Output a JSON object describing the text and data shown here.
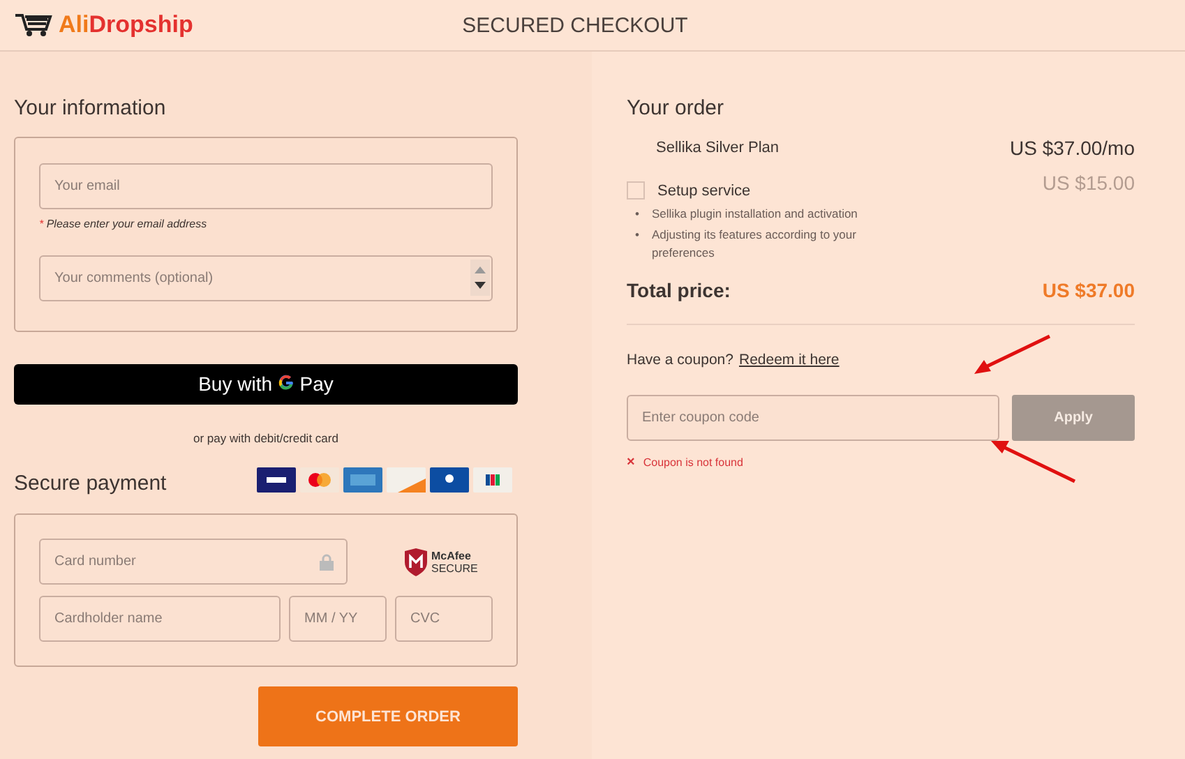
{
  "header": {
    "brand": [
      "Ali",
      "Dropship"
    ],
    "title": "SECURED CHECKOUT"
  },
  "info": {
    "heading": "Your information",
    "email": {
      "placeholder": "Your email"
    },
    "email_hint": "Please enter your email address",
    "hint_mark": "*",
    "comments": {
      "placeholder": "Your comments (optional)"
    }
  },
  "gpay_button": {
    "label": "Buy with",
    "pay": "Pay"
  },
  "or_text": "or pay with debit/credit card",
  "payment": {
    "heading": "Secure payment",
    "card_number": {
      "placeholder": "Card number"
    },
    "cardholder": {
      "placeholder": "Cardholder name"
    },
    "expiry": {
      "placeholder": "MM / YY"
    },
    "cvc": {
      "placeholder": "CVC"
    },
    "badge": {
      "name": "McAfee",
      "sub": "SECURE"
    }
  },
  "complete_button": "COMPLETE ORDER",
  "order": {
    "heading": "Your order",
    "items": [
      {
        "kind": "plan",
        "name": "Sellika Silver Plan",
        "price": "US $37.00/mo"
      },
      {
        "kind": "option",
        "name": "Setup service",
        "price": "US $15.00",
        "checked": false,
        "bullet_mark": "•",
        "bullets": [
          "Sellika plugin installation and activation",
          "Adjusting its features according to your preferences"
        ]
      }
    ],
    "total_label": "Total price:",
    "total": "US $37.00",
    "coupon_prompt": "Have a coupon?",
    "coupon_link": "Redeem it here",
    "coupon_field": {
      "placeholder": "Enter coupon code"
    },
    "apply_button": "Apply",
    "coupon_error": "Coupon is not found",
    "error_mark": "×"
  }
}
